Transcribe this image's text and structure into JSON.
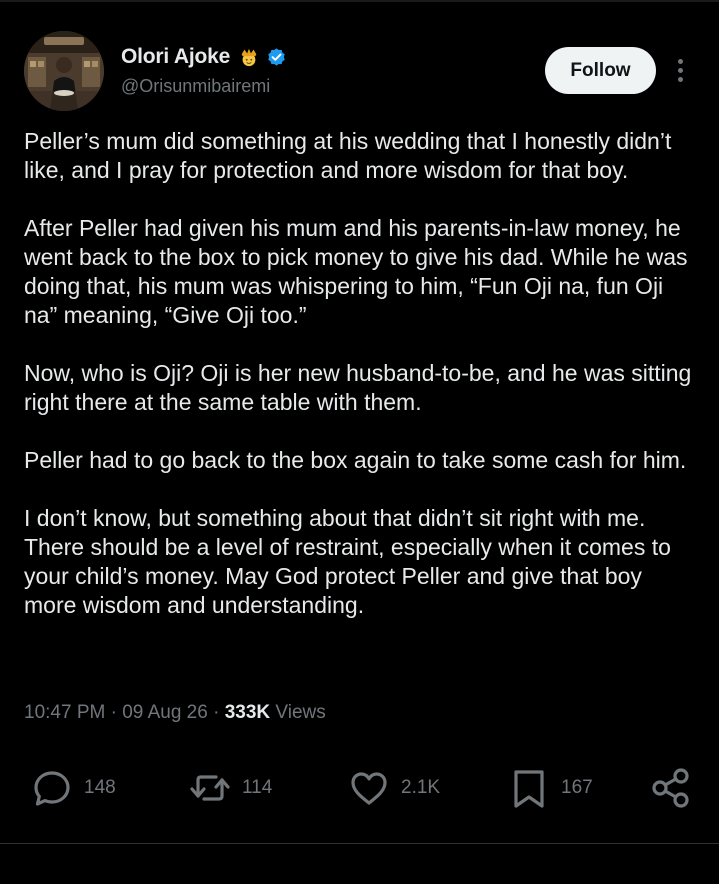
{
  "author": {
    "display_name": "Olori Ajoke",
    "handle": "@Orisunmibairemi",
    "crown_emoji": "crown-icon",
    "verified": "verified-badge-icon"
  },
  "header": {
    "follow_label": "Follow",
    "more_icon": "more-vertical-icon"
  },
  "tweet": {
    "paragraphs": [
      "Peller’s mum did something at his wedding that I honestly didn’t like, and I pray for protection and more wisdom for that boy.",
      "After Peller had given his mum and his parents-in-law money, he went back to the box to pick money to give his dad. While he was doing that, his mum was whispering to him, “Fun Oji na, fun Oji na” meaning, “Give Oji too.”",
      "Now, who is Oji? Oji is her new husband-to-be, and he was sitting right there at the same table with them.",
      "Peller had to go back to the box again to take some cash for him.",
      "I don’t know, but something about that didn’t sit right with me. There should be a level of restraint, especially when it comes to your child’s money. May God protect Peller and give that boy more wisdom and understanding."
    ]
  },
  "meta": {
    "time": "10:47 PM",
    "separator": "·",
    "date": "09 Aug 26",
    "views_count": "333K",
    "views_label": "Views"
  },
  "actions": {
    "reply_count": "148",
    "repost_count": "114",
    "like_count": "2.1K",
    "bookmark_count": "167"
  },
  "colors": {
    "background": "#000000",
    "text_primary": "#e7e9ea",
    "text_secondary": "#71767b",
    "verified_blue": "#1d9bf0",
    "follow_button_bg": "#eff3f4"
  }
}
